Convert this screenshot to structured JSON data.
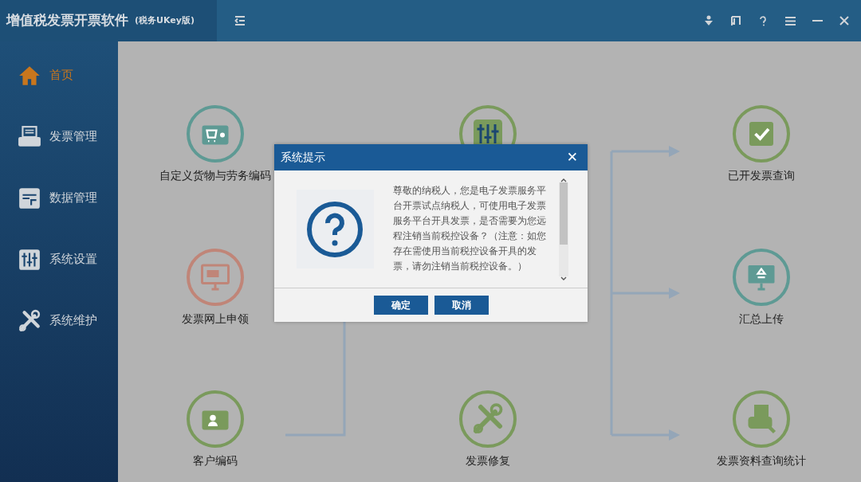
{
  "app": {
    "title": "增值税发票开票软件",
    "subtitle": "(税务UKey版)"
  },
  "sidebar": {
    "items": [
      {
        "label": "首页",
        "selected": true
      },
      {
        "label": "发票管理",
        "selected": false
      },
      {
        "label": "数据管理",
        "selected": false
      },
      {
        "label": "系统设置",
        "selected": false
      },
      {
        "label": "系统维护",
        "selected": false
      }
    ]
  },
  "nodes": [
    {
      "label": "自定义货物与劳务编码",
      "color": "#5e9a94"
    },
    {
      "color": "#7a9a5c"
    },
    {
      "label": "已开发票查询",
      "color": "#7a9a5c"
    },
    {
      "label": "发票网上申领",
      "color": "#c08578"
    },
    {
      "label": "汇总上传",
      "color": "#5e9a94"
    },
    {
      "label": "客户编码",
      "color": "#7a9a5c"
    },
    {
      "label": "发票修复",
      "color": "#7a9a5c"
    },
    {
      "label": "发票资料查询统计",
      "color": "#7a9a5c"
    }
  ],
  "dialog": {
    "title": "系统提示",
    "close": "✕",
    "message": "尊敬的纳税人，您是电子发票服务平台开票试点纳税人，可使用电子发票服务平台开具发票，是否需要为您远程注销当前税控设备？（注意：如您存在需使用当前税控设备开具的发票，请勿注销当前税控设备。）",
    "buttons": [
      "确定",
      "取消"
    ]
  }
}
